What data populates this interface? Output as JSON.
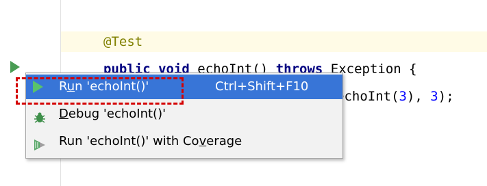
{
  "editor": {
    "annotation": "@Test",
    "signature_kw1": "public void",
    "signature_name": " echoInt() ",
    "signature_kw2": "throws",
    "signature_rest": " Exception {",
    "assert_call": "echoInt(",
    "assert_arg1": "3",
    "assert_mid": "), ",
    "assert_arg2": "3",
    "assert_end": ");"
  },
  "popup": {
    "items": [
      {
        "label_pre": "R",
        "label_mnemonic": "u",
        "label_post": "n 'echoInt()'",
        "shortcut": "Ctrl+Shift+F10",
        "icon": "run-icon"
      },
      {
        "label_pre": "",
        "label_mnemonic": "D",
        "label_post": "ebug 'echoInt()'",
        "icon": "debug-icon"
      },
      {
        "label_pre": "Run 'echoInt()' with Co",
        "label_mnemonic": "v",
        "label_post": "erage",
        "icon": "coverage-icon"
      }
    ]
  },
  "colors": {
    "selection": "#3875d7",
    "highlight_box": "#d40000",
    "run_green": "#59c26b"
  }
}
